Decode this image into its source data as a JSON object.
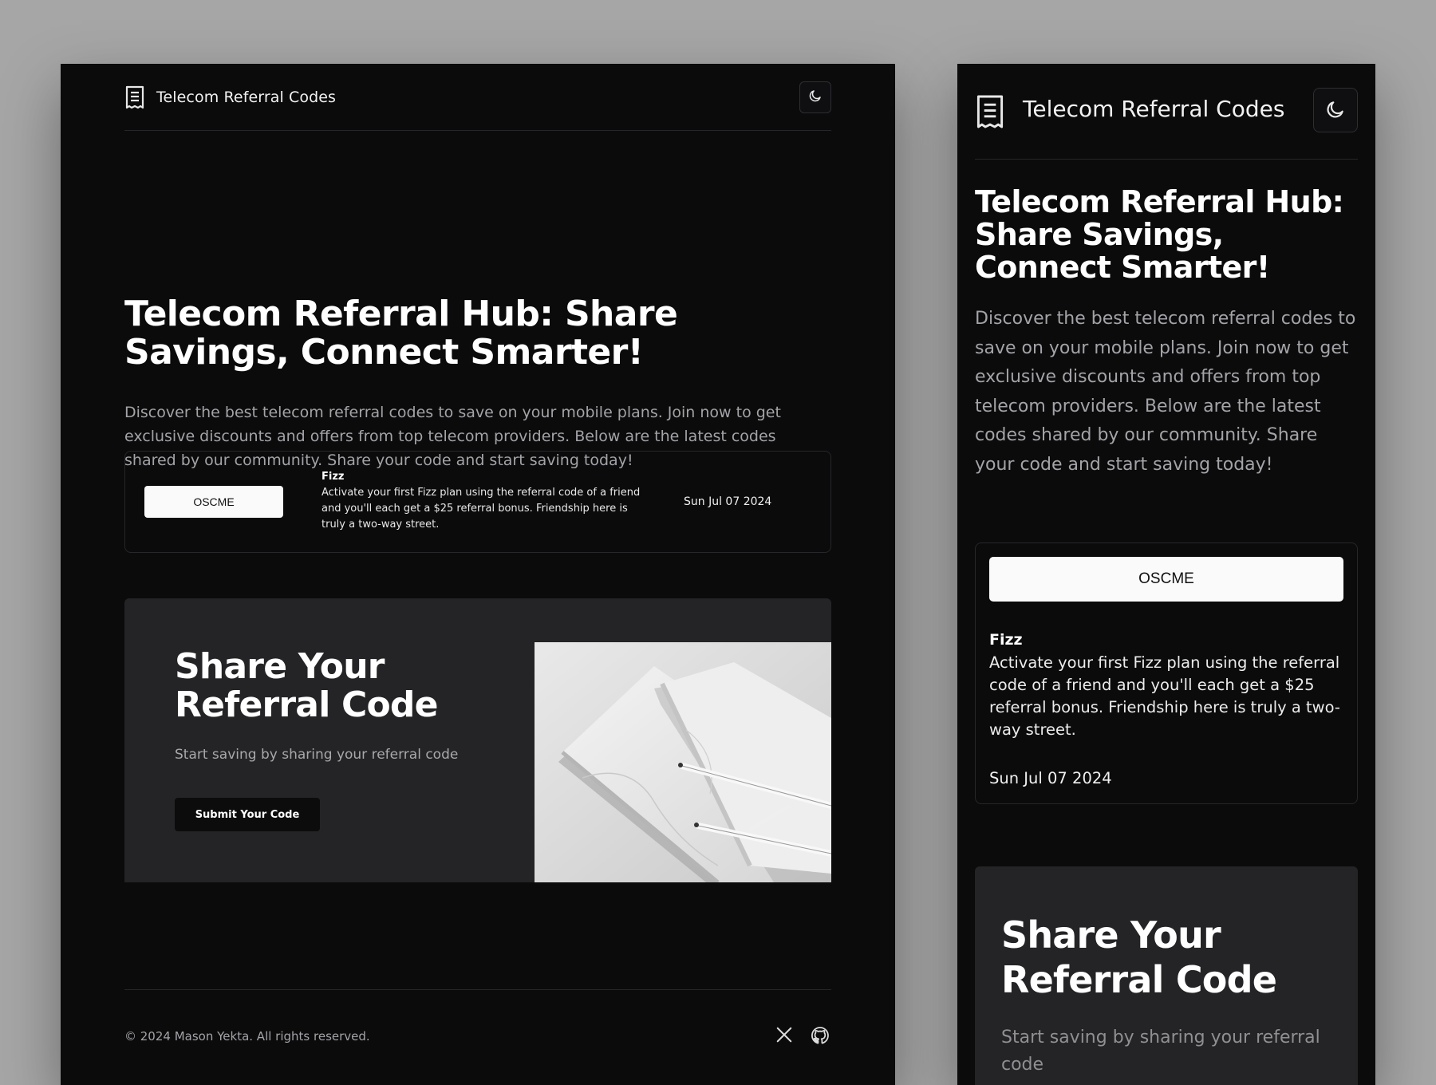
{
  "header": {
    "brand": "Telecom Referral Codes",
    "logo_icon": "receipt-icon",
    "theme_icon": "moon-icon"
  },
  "hero": {
    "title": "Telecom Referral Hub: Share Savings, Connect Smarter!",
    "description": "Discover the best telecom referral codes to save on your mobile plans. Join now to get exclusive discounts and offers from top telecom providers. Below are the latest codes shared by our community. Share your code and start saving today!"
  },
  "referrals": [
    {
      "code": "OSCME",
      "provider": "Fizz",
      "offer": "Activate your first Fizz plan using the referral code of a friend and you'll each get a $25 referral bonus. Friendship here is truly a two-way street.",
      "date": "Sun Jul 07 2024"
    }
  ],
  "share": {
    "title": "Share Your Referral Code",
    "subtitle": "Start saving by sharing your referral code",
    "button": "Submit Your Code"
  },
  "footer": {
    "copyright": "© 2024 Mason Yekta. All rights reserved.",
    "social_icons": [
      "x-icon",
      "github-icon"
    ]
  },
  "colors": {
    "page_bg": "#a6a6a6",
    "panel_bg": "#0b0b0c",
    "card_border": "#27272b",
    "share_bg": "#242426",
    "muted_text": "#a3a3a8"
  }
}
